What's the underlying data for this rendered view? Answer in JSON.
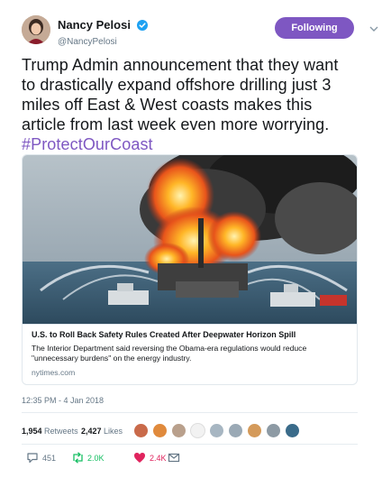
{
  "author": {
    "display_name": "Nancy Pelosi",
    "handle": "@NancyPelosi",
    "verified": true,
    "follow_label": "Following",
    "avatar_icon": "profile-photo"
  },
  "tweet": {
    "text": "Trump Admin announcement that they want to drastically expand offshore drilling just 3 miles off East & West coasts makes this article from last week even more worrying.",
    "hashtag": "#ProtectOurCoast",
    "timestamp": "12:35 PM - 4 Jan 2018"
  },
  "card": {
    "image_icon": "oil-rig-fire-photo",
    "title": "U.S. to Roll Back Safety Rules Created After Deepwater Horizon Spill",
    "description": "The Interior Department said reversing the Obama-era regulations would reduce \"unnecessary burdens\" on the energy industry.",
    "domain": "nytimes.com"
  },
  "stats": {
    "retweets_count": "1,954",
    "retweets_label": "Retweets",
    "likes_count": "2,427",
    "likes_label": "Likes"
  },
  "actions": {
    "reply_count": "451",
    "retweet_count": "2.0K",
    "like_count": "2.4K"
  },
  "colors": {
    "accent": "#7e57c2",
    "retweet": "#17bf63",
    "like": "#e0245e",
    "verified": "#1da1f2"
  }
}
